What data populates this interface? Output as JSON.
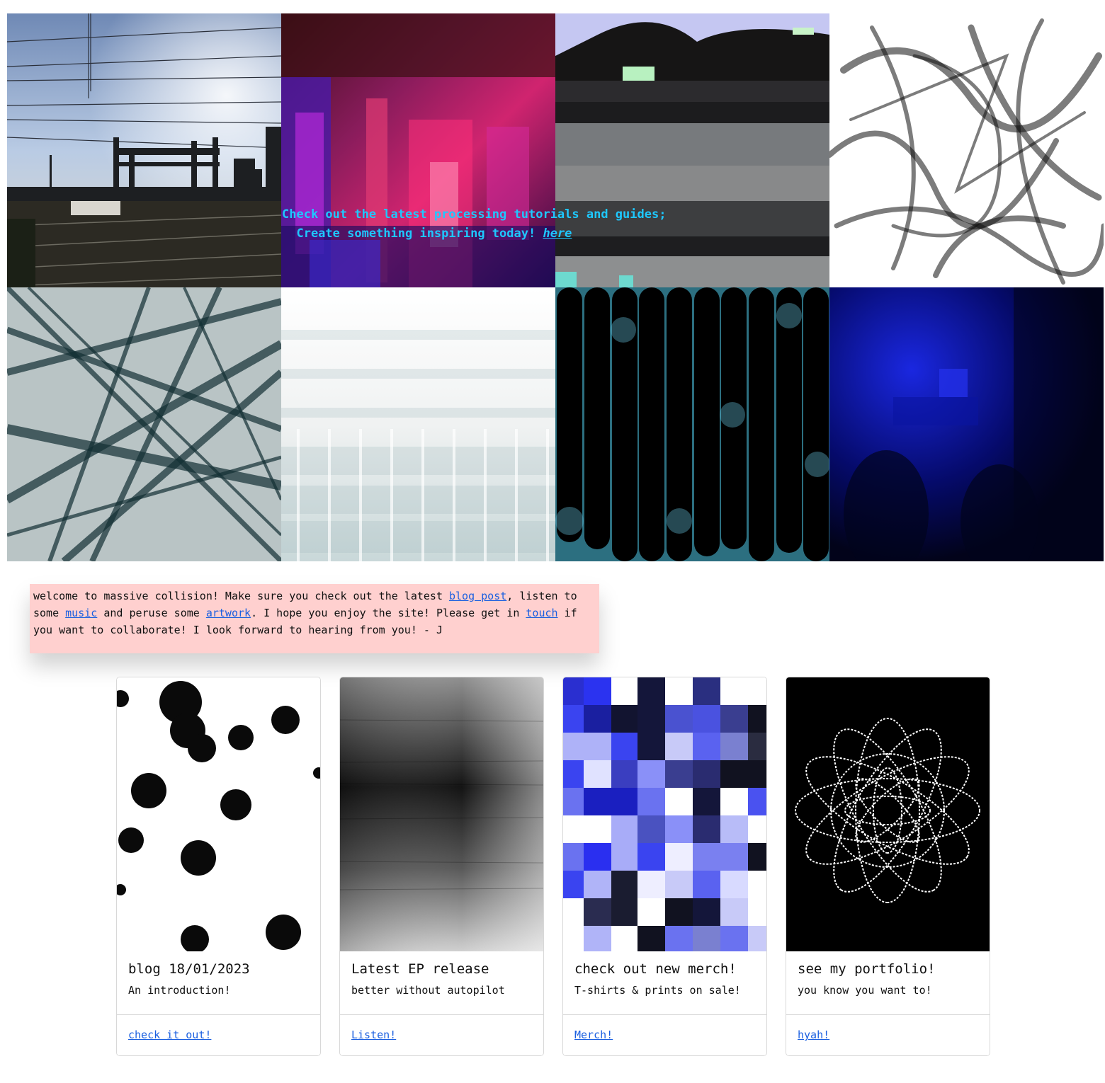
{
  "hero": {
    "line1": "Check out the latest processing tutorials and guides;",
    "line2_prefix": "  Create something inspiring today! ",
    "link_label": "here",
    "accent_color": "#1ec8ff"
  },
  "welcome": {
    "t1": "welcome to massive collision! Make sure you check out the latest ",
    "blog_link": "blog post",
    "t2": ", listen to some ",
    "music_link": "music",
    "t3": " and peruse some ",
    "artwork_link": "artwork",
    "t4": ". I hope you enjoy the site! Please get in ",
    "touch_link": "touch",
    "t5": " if you want to collaborate! I look forward to hearing from you! - J",
    "background": "#ffd0cf"
  },
  "cards": [
    {
      "title": "blog 18/01/2023",
      "text": "An introduction!",
      "link": "check it out!"
    },
    {
      "title": "Latest EP release",
      "text": "better without autopilot",
      "link": "Listen!"
    },
    {
      "title": "check out new merch!",
      "text": "T-shirts & prints on sale!",
      "link": "Merch!"
    },
    {
      "title": "see my portfolio!",
      "text": "you know you want to!",
      "link": "hyah!"
    }
  ],
  "link_color": "#1a5fe0"
}
